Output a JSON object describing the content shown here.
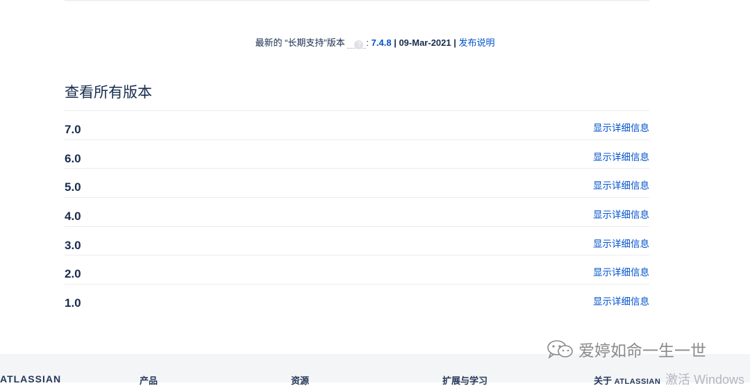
{
  "lts": {
    "label": "最新的 “长期支持”版本",
    "help_glyph": "?",
    "colon": ":",
    "version": "7.4.8",
    "sep1": "|",
    "date": "09-Mar-2021",
    "sep2": "|",
    "release_notes": "发布说明"
  },
  "all_versions": {
    "title": "查看所有版本",
    "details_label": "显示详细信息",
    "items": [
      {
        "version": "7.0",
        "details": "显示详细信息"
      },
      {
        "version": "6.0",
        "details": "显示详细信息"
      },
      {
        "version": "5.0",
        "details": "显示详细信息"
      },
      {
        "version": "4.0",
        "details": "显示详细信息"
      },
      {
        "version": "3.0",
        "details": "显示详细信息"
      },
      {
        "version": "2.0",
        "details": "显示详细信息"
      },
      {
        "version": "1.0",
        "details": "显示详细信息"
      }
    ]
  },
  "footer": {
    "brand": "ATLASSIAN",
    "products": "产品",
    "resources": "资源",
    "expand_learn": "扩展与学习",
    "about_prefix": "关于",
    "about_brand": "ATLASSIAN"
  },
  "watermark": {
    "text": "爱婷如命一生一世",
    "icon": "wechat-icon"
  },
  "activate": "激活 Windows",
  "colors": {
    "link": "#0052cc",
    "text": "#172b4d",
    "divider": "#ebecf0",
    "footer_bg": "#f4f5f7"
  }
}
